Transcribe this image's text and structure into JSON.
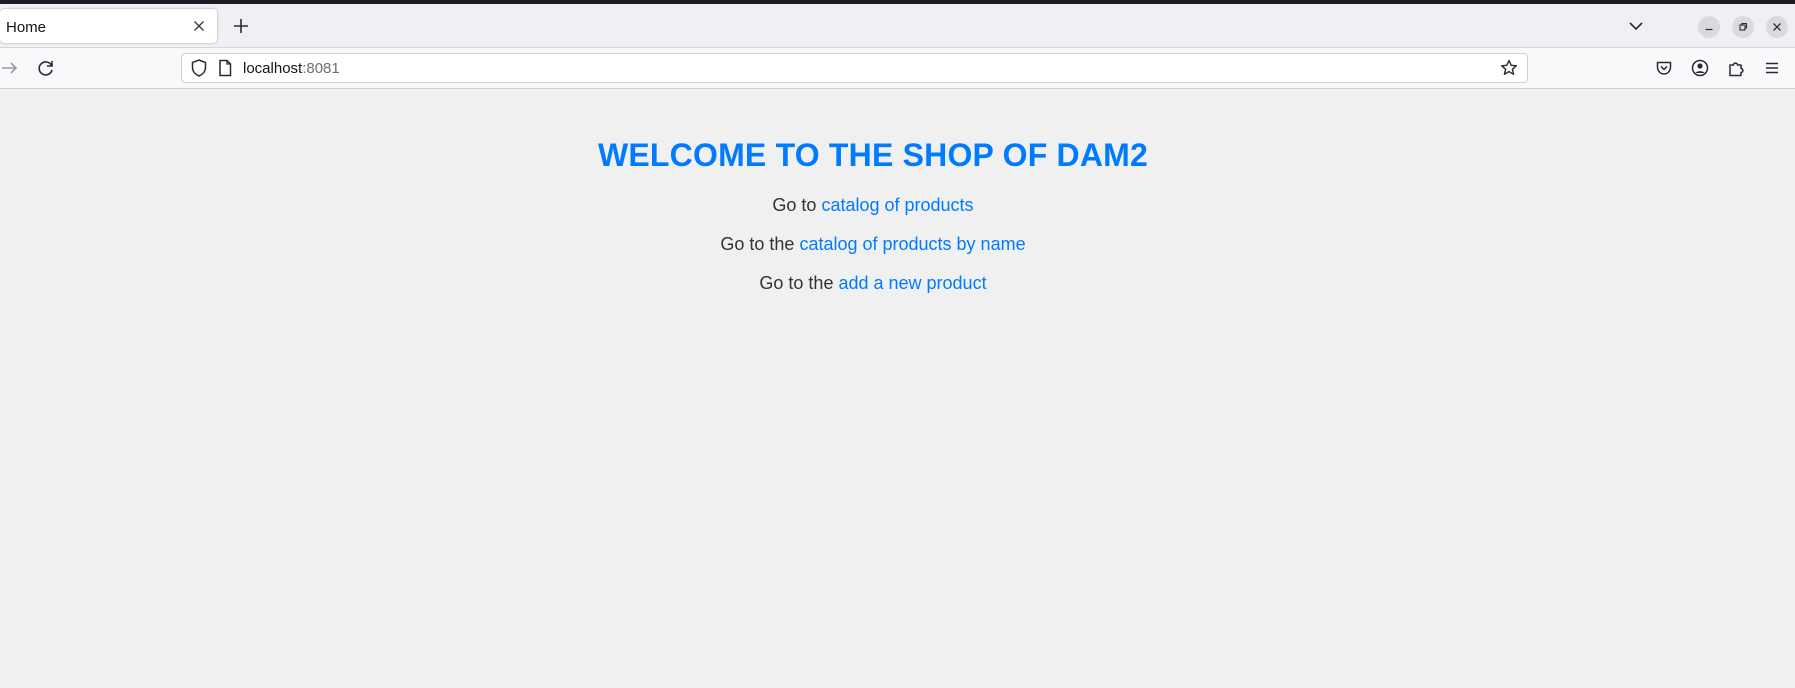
{
  "browser": {
    "tab": {
      "title": "Home"
    },
    "address": {
      "host": "localhost",
      "port": ":8081"
    },
    "icons": {
      "tab_close": "close-icon",
      "new_tab": "plus-icon",
      "list_tabs": "chevron-down-icon",
      "back": "arrow-right-icon",
      "reload": "reload-icon",
      "shield": "shield-icon",
      "page": "page-icon",
      "bookmark": "star-icon",
      "pocket": "pocket-icon",
      "account": "account-icon",
      "extensions": "puzzle-icon",
      "menu": "hamburger-menu-icon"
    }
  },
  "page": {
    "heading": "WELCOME TO THE SHOP OF DAM2",
    "links": [
      {
        "prefix": "Go to ",
        "label": "catalog of products"
      },
      {
        "prefix": "Go to the ",
        "label": "catalog of products by name"
      },
      {
        "prefix": "Go to the ",
        "label": "add a new product"
      }
    ]
  },
  "colors": {
    "accent": "#007bff",
    "text": "#333333",
    "background": "#f0f0f0"
  }
}
